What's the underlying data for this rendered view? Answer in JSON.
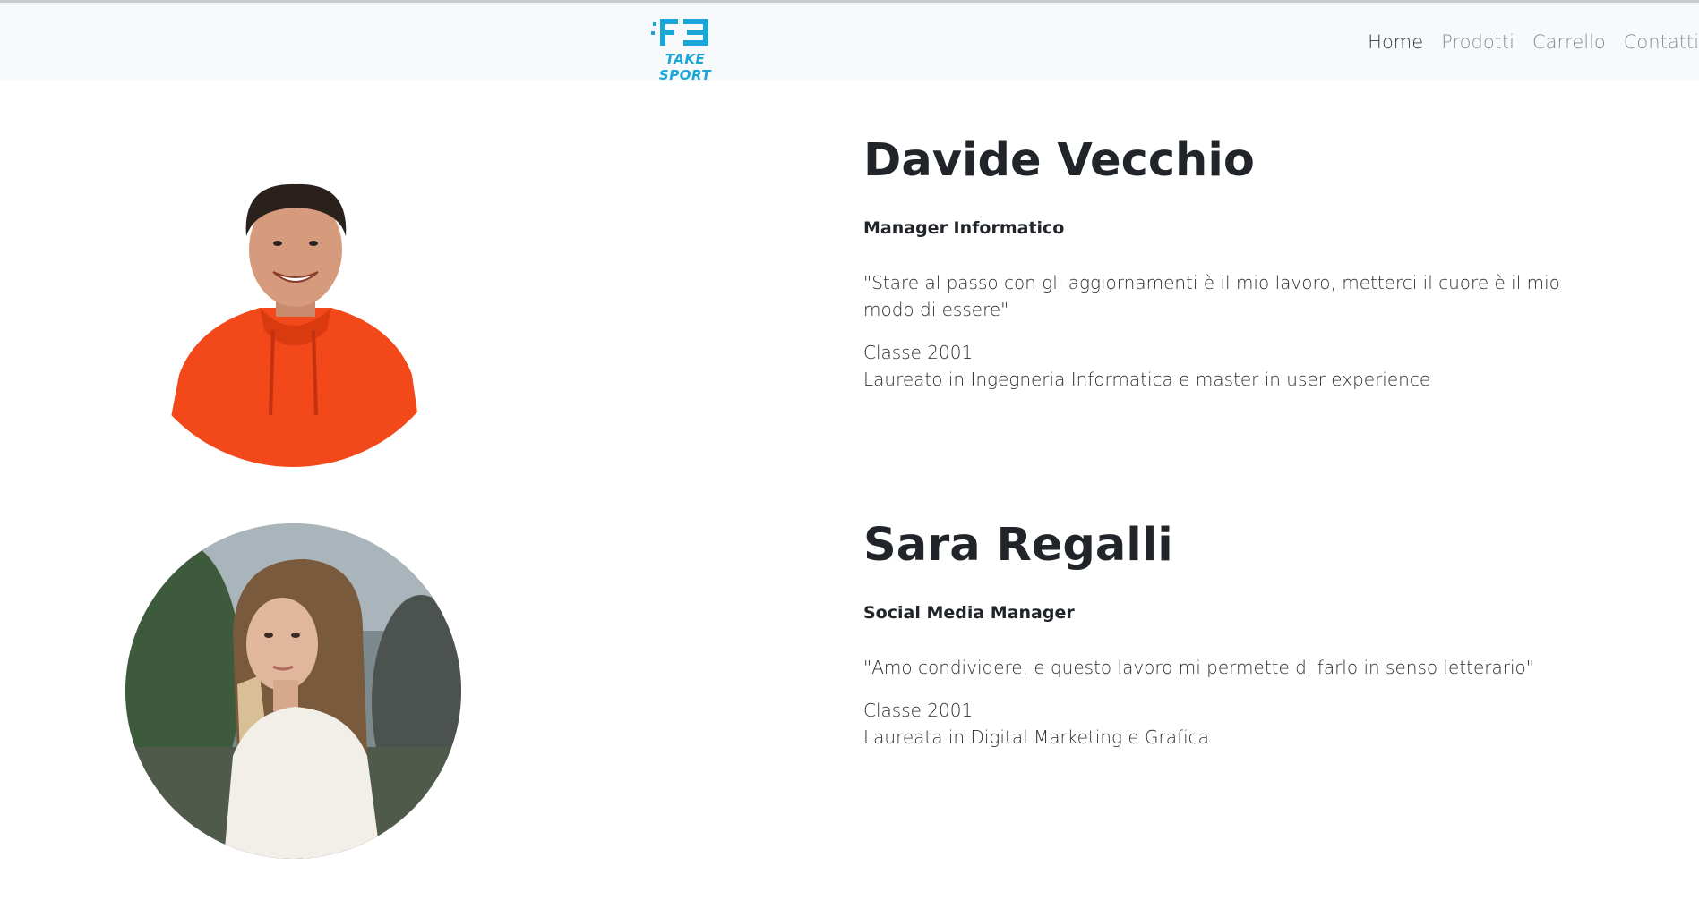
{
  "brand": {
    "logo_text": "TAKE SPORT",
    "accent_color": "#1aa6d6"
  },
  "nav": {
    "items": [
      {
        "label": "Home",
        "active": true
      },
      {
        "label": "Prodotti",
        "active": false
      },
      {
        "label": "Carrello",
        "active": false
      },
      {
        "label": "Contatti",
        "active": false
      }
    ]
  },
  "team": [
    {
      "name": "Davide Vecchio",
      "role": "Manager Informatico",
      "quote": "\"Stare al passo con gli aggiornamenti è il mio lavoro, metterci il cuore è il mio modo di essere\"",
      "class_year": "Classe 2001",
      "education": "Laureato in Ingegneria Informatica e master in user experience",
      "photo": "portrait-man-orange-hoodie"
    },
    {
      "name": "Sara Regalli",
      "role": "Social Media Manager",
      "quote": "\"Amo condividere, e questo lavoro mi permette di farlo in senso letterario\"",
      "class_year": "Classe 2001",
      "education": "Laureata in Digital Marketing e Grafica",
      "photo": "portrait-woman-white-sweater"
    }
  ]
}
